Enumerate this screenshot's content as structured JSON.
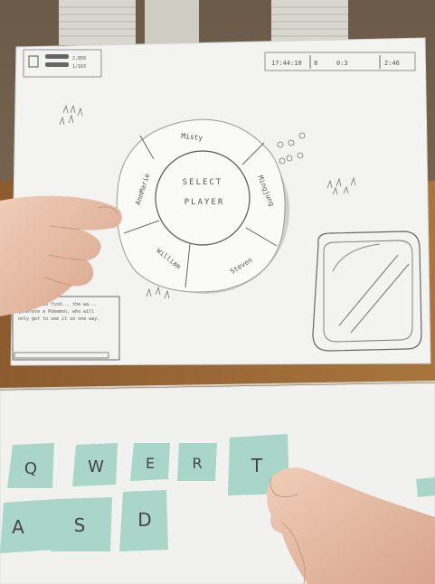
{
  "hud": {
    "left_icon": "map-icon",
    "stats": [
      "2,850",
      "1/163"
    ],
    "time": "17:44:10",
    "resources": [
      "8",
      "0:3",
      "2:46"
    ]
  },
  "select_wheel": {
    "center_label_line1": "SELECT",
    "center_label_line2": "PLAYER",
    "players": [
      "Misty",
      "Mingjung",
      "Steven",
      "William",
      "AnnMarie"
    ]
  },
  "chat_box": {
    "text_line1": "...ever you find... the wa...",
    "text_line2": "generate a Pokemon, who will",
    "text_line3": "only get to see it on one way."
  },
  "keys_row1": [
    "Q",
    "W",
    "E",
    "R",
    "T"
  ],
  "keys_row2": [
    "A",
    "S",
    "D"
  ],
  "colors": {
    "paper": "#f4f4f2",
    "key_tape": "#a9d6c8",
    "table": "#9a6b3a",
    "skin": "#e8c2ad"
  }
}
